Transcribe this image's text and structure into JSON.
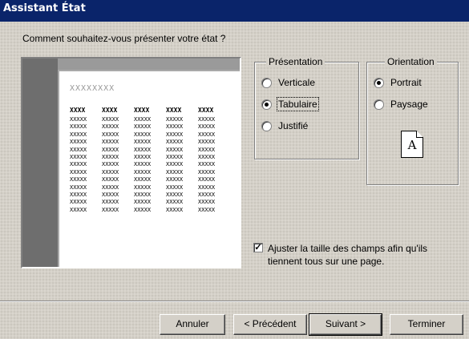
{
  "window": {
    "title": "Assistant État"
  },
  "question": "Comment souhaitez-vous présenter votre état ?",
  "preview": {
    "sample_title": "XXXXXXXX",
    "header_cells": [
      "XXXX",
      "XXXX",
      "XXXX",
      "XXXX",
      "XXXX"
    ],
    "cell_text": "XXXXX",
    "row_count": 13,
    "column_count": 5
  },
  "presentation": {
    "legend": "Présentation",
    "options": [
      {
        "label": "Verticale",
        "selected": false
      },
      {
        "label": "Tabulaire",
        "selected": true
      },
      {
        "label": "Justifié",
        "selected": false
      }
    ]
  },
  "orientation": {
    "legend": "Orientation",
    "options": [
      {
        "label": "Portrait",
        "selected": true
      },
      {
        "label": "Paysage",
        "selected": false
      }
    ],
    "icon_letter": "A"
  },
  "fit_checkbox": {
    "checked": true,
    "label": "Ajuster la taille des champs afin qu'ils tiennent tous sur une page."
  },
  "buttons": {
    "cancel": "Annuler",
    "previous": "< Précédent",
    "next": "Suivant >",
    "finish": "Terminer"
  },
  "colors": {
    "title_bar": "#0a246a",
    "dialog_face": "#d4d0c8"
  }
}
